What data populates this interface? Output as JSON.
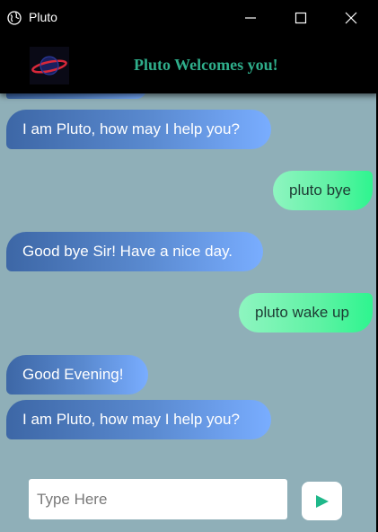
{
  "window": {
    "title": "Pluto",
    "icons": {
      "app": "globe-icon",
      "minimize": "minimize-icon",
      "maximize": "maximize-icon",
      "close": "close-icon"
    }
  },
  "header": {
    "logo": "pluto-logo",
    "title": "Pluto Welcomes you!",
    "title_color": "#2fae8b"
  },
  "chat": {
    "messages": [
      {
        "from": "bot",
        "text": "I am Pluto, how may I help you?"
      },
      {
        "from": "user",
        "text": "pluto bye"
      },
      {
        "from": "bot",
        "text": "Good bye Sir! Have a nice day."
      },
      {
        "from": "user",
        "text": "pluto wake up"
      },
      {
        "from": "bot",
        "text": "Good Evening!"
      },
      {
        "from": "bot",
        "text": "I am Pluto, how may I help you?"
      }
    ]
  },
  "composer": {
    "placeholder": "Type Here",
    "value": "",
    "send_icon": "send-icon"
  },
  "colors": {
    "chat_background": "#8fafb8",
    "bot_bubble": "#5a8ad0",
    "user_bubble": "#5ff2a4"
  }
}
